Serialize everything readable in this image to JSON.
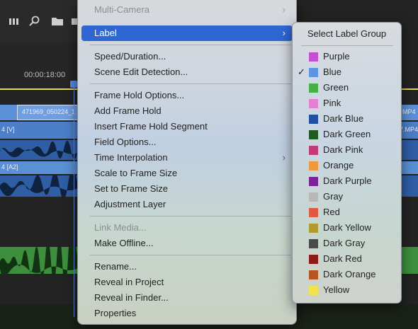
{
  "timeline": {
    "timecode": "00:00:18:00",
    "clip_name": "471969_050224_1",
    "track_video": "4 [V]",
    "track_audio": "4 [A2]",
    "right_clip_1": "MP4",
    "right_clip_2": "7.MP4"
  },
  "menu": {
    "items": [
      {
        "label": "Multi-Camera",
        "disabled": true,
        "submenu": true
      },
      {
        "label": "Label",
        "active": true,
        "submenu": true
      },
      {
        "label": "Speed/Duration..."
      },
      {
        "label": "Scene Edit Detection..."
      },
      {
        "label": "Frame Hold Options..."
      },
      {
        "label": "Add Frame Hold"
      },
      {
        "label": "Insert Frame Hold Segment"
      },
      {
        "label": "Field Options..."
      },
      {
        "label": "Time Interpolation",
        "submenu": true
      },
      {
        "label": "Scale to Frame Size"
      },
      {
        "label": "Set to Frame Size"
      },
      {
        "label": "Adjustment Layer"
      },
      {
        "label": "Link Media...",
        "disabled": true
      },
      {
        "label": "Make Offline..."
      },
      {
        "label": "Rename..."
      },
      {
        "label": "Reveal in Project"
      },
      {
        "label": "Reveal in Finder..."
      },
      {
        "label": "Properties"
      }
    ],
    "chevron": "›"
  },
  "submenu": {
    "header": "Select Label Group",
    "checkmark": "✓",
    "labels": [
      {
        "name": "Purple",
        "color": "#c54fd0"
      },
      {
        "name": "Blue",
        "color": "#5e95e3",
        "checked": true
      },
      {
        "name": "Green",
        "color": "#45b043"
      },
      {
        "name": "Pink",
        "color": "#e57fd0"
      },
      {
        "name": "Dark Blue",
        "color": "#1e4fa3"
      },
      {
        "name": "Dark Green",
        "color": "#1f5a22"
      },
      {
        "name": "Dark Pink",
        "color": "#c43a78"
      },
      {
        "name": "Orange",
        "color": "#ee9a3c"
      },
      {
        "name": "Dark Purple",
        "color": "#7b2296"
      },
      {
        "name": "Gray",
        "color": "#b8b8b8"
      },
      {
        "name": "Red",
        "color": "#df5a3f"
      },
      {
        "name": "Dark Yellow",
        "color": "#b39a2e"
      },
      {
        "name": "Dark Gray",
        "color": "#4a4a4a"
      },
      {
        "name": "Dark Red",
        "color": "#8e1a17"
      },
      {
        "name": "Dark Orange",
        "color": "#b4561f"
      },
      {
        "name": "Yellow",
        "color": "#f1e24e"
      }
    ]
  }
}
